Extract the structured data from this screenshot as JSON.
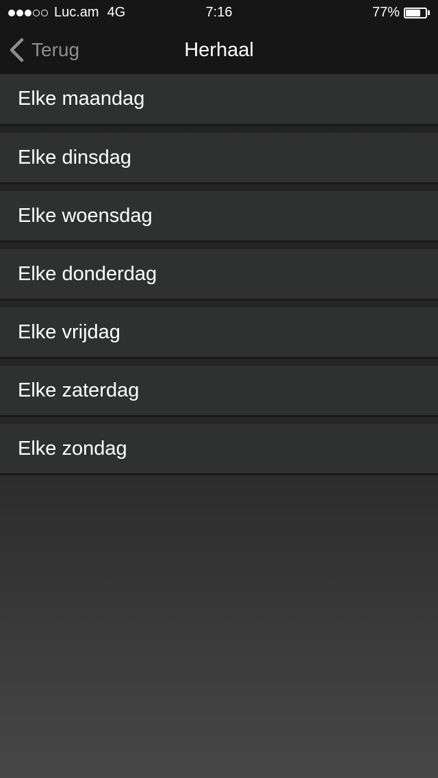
{
  "status_bar": {
    "signal_dots": [
      "filled",
      "filled",
      "filled",
      "empty",
      "empty"
    ],
    "carrier": "Luc.am",
    "network": "4G",
    "time": "7:16",
    "battery_percent": "77%",
    "battery_level": 0.77
  },
  "nav": {
    "back_label": "Terug",
    "back_icon": "chevron-left-icon",
    "title": "Herhaal"
  },
  "days": [
    {
      "label": "Elke maandag"
    },
    {
      "label": "Elke dinsdag"
    },
    {
      "label": "Elke woensdag"
    },
    {
      "label": "Elke donderdag"
    },
    {
      "label": "Elke vrijdag"
    },
    {
      "label": "Elke zaterdag"
    },
    {
      "label": "Elke zondag"
    }
  ],
  "colors": {
    "bar_background": "#161616",
    "row_background": "#2f3131",
    "back_label": "#8e8e8e",
    "text": "#ffffff"
  }
}
